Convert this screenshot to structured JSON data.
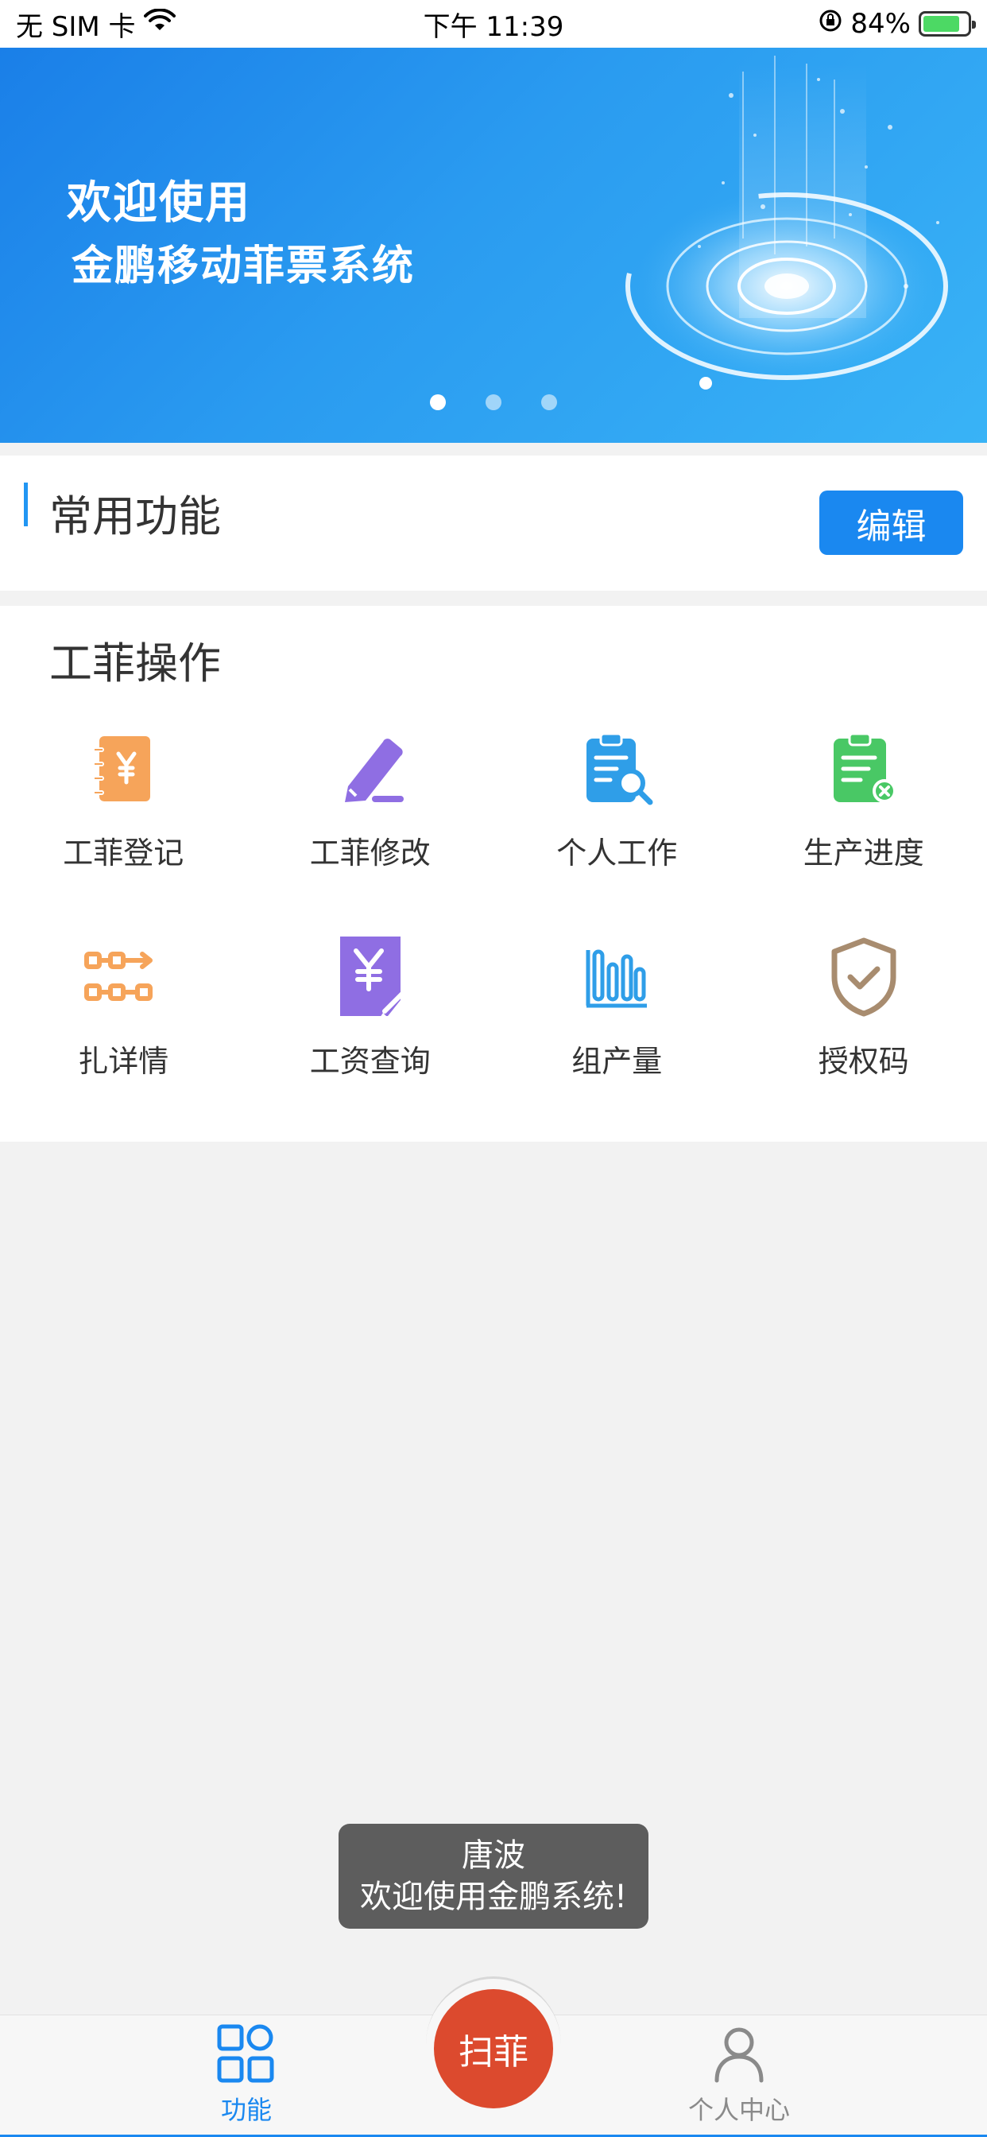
{
  "status_bar": {
    "carrier": "无 SIM 卡",
    "time": "下午 11:39",
    "battery": "84%",
    "battery_level": 0.84
  },
  "banner": {
    "title": "欢迎使用",
    "subtitle": "金鹏移动菲票系统",
    "slide_count": 3,
    "active_slide": 1
  },
  "common": {
    "title": "常用功能",
    "edit_label": "编辑"
  },
  "operations": {
    "title": "工菲操作",
    "items": [
      {
        "label": "工菲登记",
        "icon": "notebook-yen-icon",
        "color": "#f6a45a"
      },
      {
        "label": "工菲修改",
        "icon": "pencil-edit-icon",
        "color": "#8f6ee3"
      },
      {
        "label": "个人工作",
        "icon": "clipboard-search-icon",
        "color": "#2f9ee8"
      },
      {
        "label": "生产进度",
        "icon": "clipboard-progress-icon",
        "color": "#49c865"
      },
      {
        "label": "扎详情",
        "icon": "bundle-flow-icon",
        "color": "#f6a45a"
      },
      {
        "label": "工资查询",
        "icon": "salary-document-icon",
        "color": "#8f6ee3"
      },
      {
        "label": "组产量",
        "icon": "bar-chart-icon",
        "color": "#2f9ee8"
      },
      {
        "label": "授权码",
        "icon": "shield-check-icon",
        "color": "#a88c6f"
      }
    ]
  },
  "toast": {
    "line1": "唐波",
    "line2": "欢迎使用金鹏系统!"
  },
  "tab_bar": {
    "func_label": "功能",
    "scan_label": "扫菲",
    "personal_label": "个人中心",
    "active_color": "#1a88f0"
  }
}
